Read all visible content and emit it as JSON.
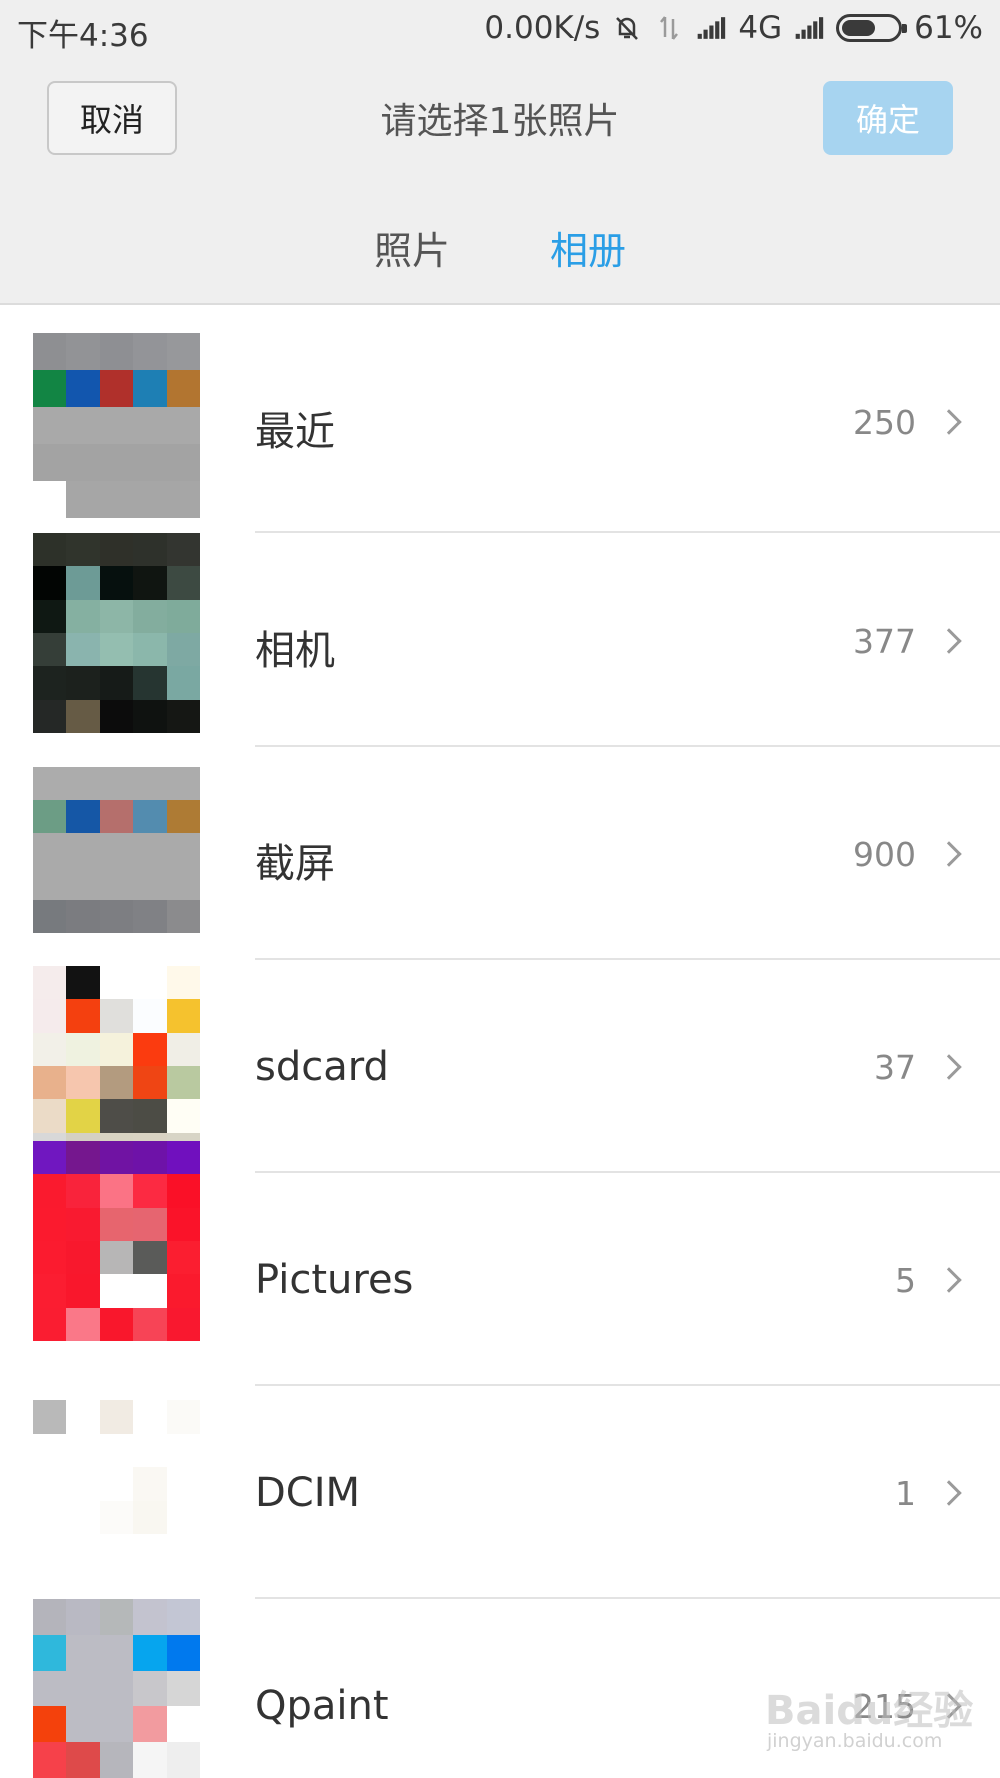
{
  "status_bar": {
    "time": "下午4:36",
    "net_speed": "0.00K/s",
    "network": "4G",
    "battery": "61%",
    "battery_level": 0.61,
    "icons": [
      "mute-bell-icon",
      "data-transfer-icon",
      "signal-icon",
      "signal-icon-2",
      "battery-icon"
    ]
  },
  "header": {
    "cancel_label": "取消",
    "title": "请选择1张照片",
    "confirm_label": "确定",
    "confirm_color": "#a7d4f0"
  },
  "tabs": [
    {
      "label": "照片",
      "active": false
    },
    {
      "label": "相册",
      "active": true
    }
  ],
  "accent_color": "#2a9ee6",
  "albums": [
    {
      "name": "最近",
      "count": "250",
      "thumb": [
        "#8e8f92",
        "#929396",
        "#8e8f93",
        "#939498",
        "#97989b",
        "#128544",
        "#1256ae",
        "#b0302b",
        "#1e7fb4",
        "#b27530",
        "#a9a9a9",
        "#a9a9a9",
        "#a9a9a9",
        "#a9a9a9",
        "#a9a9a9",
        "#a3a3a3",
        "#a3a3a3",
        "#a3a3a3",
        "#a3a3a3",
        "#a3a3a3",
        "#ffffff",
        "#a6a6a6",
        "#a6a6a6",
        "#a6a6a6",
        "#a6a6a6"
      ]
    },
    {
      "name": "相机",
      "count": "377",
      "thumb": [
        "#2d3129",
        "#30342c",
        "#2f3029",
        "#2e312b",
        "#333530",
        "#020503",
        "#6d9b96",
        "#06100e",
        "#101511",
        "#3d4a42",
        "#0f1813",
        "#85b0a1",
        "#8db6a7",
        "#83ad9e",
        "#7fab9b",
        "#353e38",
        "#8ab4ae",
        "#94beb0",
        "#8bb7ab",
        "#7ea9a3",
        "#1d231f",
        "#1c211d",
        "#161b18",
        "#263531",
        "#7aa8a2",
        "#252826",
        "#665b45",
        "#0c0c0c",
        "#0f1210",
        "#151714"
      ]
    },
    {
      "name": "截屏",
      "count": "900",
      "thumb": [
        "#acacac",
        "#acacac",
        "#acacac",
        "#acacac",
        "#acacac",
        "#6c9d85",
        "#1557a6",
        "#b56f6c",
        "#538caf",
        "#ae7b34",
        "#aaaaaa",
        "#aaaaaa",
        "#aaaaaa",
        "#aaaaaa",
        "#aaaaaa",
        "#aaaaaa",
        "#aaaaaa",
        "#aaaaaa",
        "#aaaaaa",
        "#aaaaaa",
        "#777a7e",
        "#7b7c80",
        "#7d7e82",
        "#808185",
        "#8b8b8d"
      ]
    },
    {
      "name": "sdcard",
      "count": "37",
      "thumb": [
        "#f5ecec",
        "#121212",
        "#ffffff",
        "#ffffff",
        "#fff9ea",
        "#f5ebec",
        "#f4400f",
        "#e0dfdc",
        "#fbfdff",
        "#f5c22e",
        "#f2f0e8",
        "#eff2e0",
        "#f5f2dc",
        "#fb3b0f",
        "#f0eee6",
        "#e8b18c",
        "#f6c6ae",
        "#b39b7f",
        "#ef4514",
        "#b9c9a0",
        "#ebdbc7",
        "#e2d346",
        "#4e4d48",
        "#4c4c45",
        "#fffef5",
        "#d8d8d8",
        "#d4d0c2",
        "#d8d3c2",
        "#d9d3c3",
        "#d8d5c6"
      ]
    },
    {
      "name": "Pictures",
      "count": "5",
      "thumb": [
        "#7017c0",
        "#75178e",
        "#7013a3",
        "#6e12a8",
        "#7010be",
        "#fa1a2e",
        "#f9233b",
        "#fb7385",
        "#fc2a42",
        "#fa1027",
        "#fb1a2e",
        "#f91a30",
        "#e7656e",
        "#e66570",
        "#fa1329",
        "#fb1b2f",
        "#f8182d",
        "#b7b6b6",
        "#5a5b59",
        "#fb1e30",
        "#fb1d31",
        "#f9172c",
        "#ffffff",
        "#ffffff",
        "#fa1a2d",
        "#fa1d31",
        "#fa7888",
        "#f9172c",
        "#f74456",
        "#f9182f"
      ]
    },
    {
      "name": "DCIM",
      "count": "1",
      "thumb": [
        "#b9b9b9",
        "#ffffff",
        "#f1ebe3",
        "#ffffff",
        "#fbfaf7",
        "#ffffff",
        "#ffffff",
        "#ffffff",
        "#ffffff",
        "#ffffff",
        "#ffffff",
        "#ffffff",
        "#ffffff",
        "#faf8f3",
        "#ffffff",
        "#ffffff",
        "#ffffff",
        "#fcfbf9",
        "#f9f7f1",
        "#ffffff",
        "#ffffff",
        "#ffffff",
        "#ffffff",
        "#ffffff",
        "#ffffff"
      ]
    },
    {
      "name": "Qpaint",
      "count": "215",
      "thumb": [
        "#b4b4bb",
        "#b9b9c3",
        "#b5b8b9",
        "#c3c3cf",
        "#c3c6d4",
        "#2fb8dc",
        "#bcbcc4",
        "#bcbcc4",
        "#06a5ee",
        "#0079ee",
        "#bcbcc4",
        "#bcbcc4",
        "#bcbcc4",
        "#c8c7cb",
        "#d6d6d6",
        "#f4410c",
        "#bcbcc4",
        "#bcbcc4",
        "#f29b9f",
        "#ffffff",
        "#f6414a",
        "#de4a4a",
        "#b6b6bc",
        "#f5f5f5",
        "#eeeeee"
      ]
    }
  ],
  "watermark": {
    "text": "Baidu经验",
    "url": "jingyan.baidu.com"
  }
}
